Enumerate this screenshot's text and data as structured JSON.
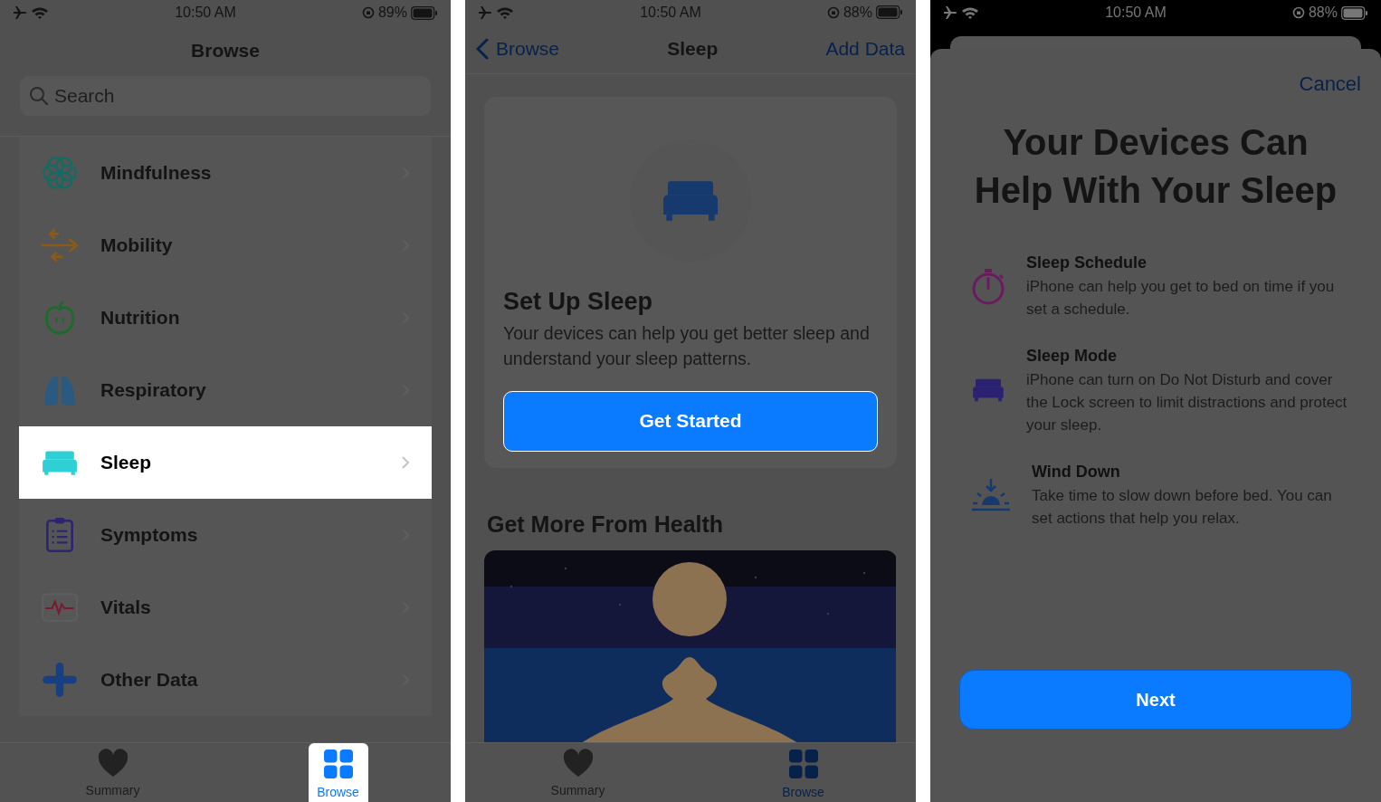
{
  "screens": [
    {
      "kind": "browse",
      "status_bar": {
        "time": "10:50 AM",
        "battery": "89%"
      },
      "title": "Browse",
      "search": {
        "placeholder": "Search"
      },
      "categories": [
        {
          "label": "Mindfulness",
          "highlighted": false
        },
        {
          "label": "Mobility",
          "highlighted": false
        },
        {
          "label": "Nutrition",
          "highlighted": false
        },
        {
          "label": "Respiratory",
          "highlighted": false
        },
        {
          "label": "Sleep",
          "highlighted": true
        },
        {
          "label": "Symptoms",
          "highlighted": false
        },
        {
          "label": "Vitals",
          "highlighted": false
        },
        {
          "label": "Other Data",
          "highlighted": false
        }
      ],
      "tab_bar": [
        {
          "label": "Summary",
          "selected": false,
          "highlighted": false
        },
        {
          "label": "Browse",
          "selected": true,
          "highlighted": true
        }
      ]
    },
    {
      "kind": "detail",
      "status_bar": {
        "time": "10:50 AM",
        "battery": "88%"
      },
      "back": "Browse",
      "title": "Sleep",
      "action": "Add Data",
      "setup": {
        "title": "Set Up Sleep",
        "text": "Your devices can help you get better sleep and understand your sleep patterns.",
        "button": "Get Started",
        "highlighted": true
      },
      "section_title": "Get More From Health",
      "tab_bar": [
        {
          "label": "Summary",
          "selected": false,
          "highlighted": false
        },
        {
          "label": "Browse",
          "selected": true,
          "highlighted": false
        }
      ]
    },
    {
      "kind": "sheet",
      "status_bar": {
        "time": "10:50 AM",
        "battery": "88%"
      },
      "cancel": "Cancel",
      "title": "Your Devices Can Help With Your Sleep",
      "features": [
        {
          "title": "Sleep Schedule",
          "text": "iPhone can help you get to bed on time if you set a schedule."
        },
        {
          "title": "Sleep Mode",
          "text": "iPhone can turn on Do Not Disturb and cover the Lock screen to limit distractions and protect your sleep."
        },
        {
          "title": "Wind Down",
          "text": "Take time to slow down before bed. You can set actions that help you relax."
        }
      ],
      "button": {
        "label": "Next",
        "highlighted": true
      }
    }
  ]
}
